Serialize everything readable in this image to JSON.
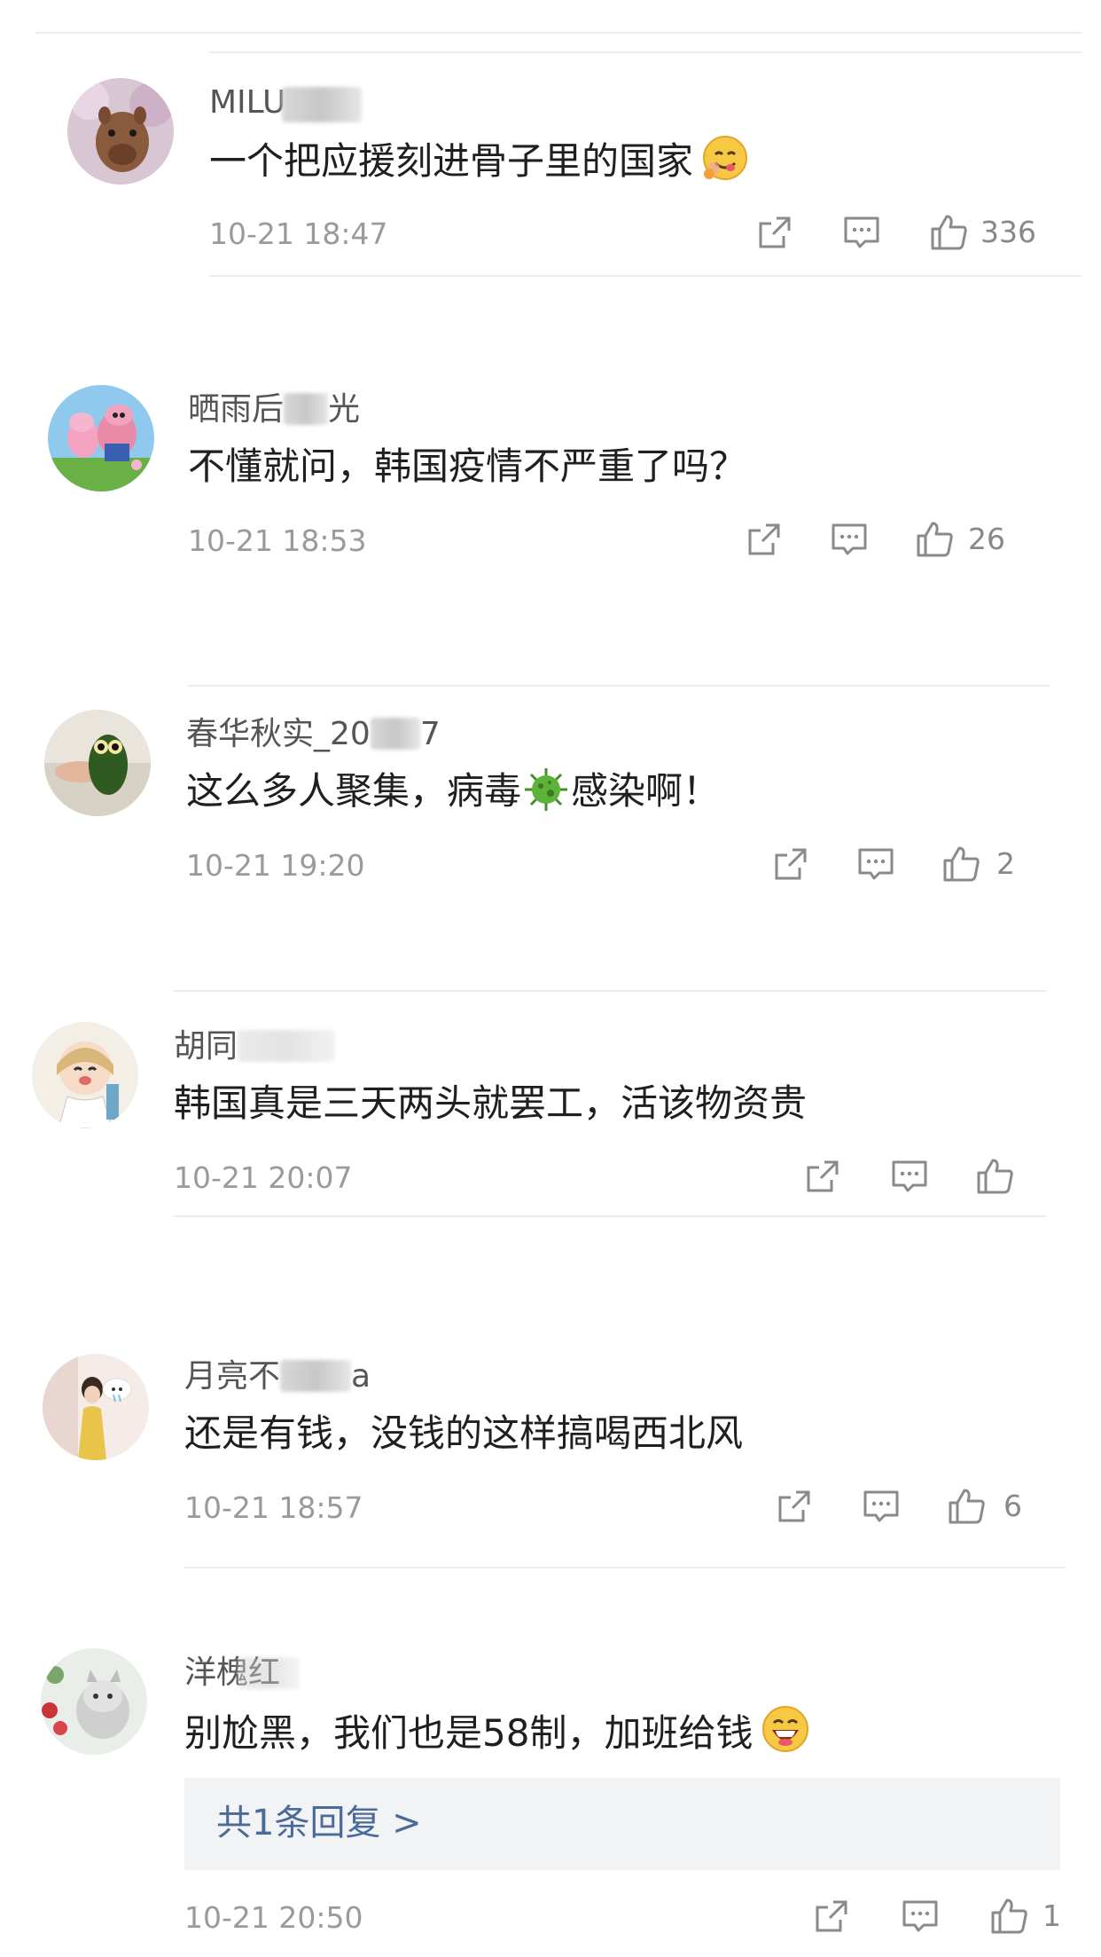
{
  "comments": [
    {
      "name": "MILU",
      "text": "一个把应援刻进骨子里的国家",
      "time": "10-21 18:47",
      "likes": "336",
      "emoji": "face-savoring-icon"
    },
    {
      "name": "晒雨后",
      "name_tail": "光",
      "text": "不懂就问，韩国疫情不严重了吗？",
      "time": "10-21 18:53",
      "likes": "26"
    },
    {
      "name": "春华秋实_20",
      "name_tail": "7",
      "text_a": "这么多人聚集，病毒",
      "text_b": "感染啊！",
      "time": "10-21 19:20",
      "likes": "2"
    },
    {
      "name": "胡同",
      "text": "韩国真是三天两头就罢工，活该物资贵",
      "time": "10-21 20:07",
      "likes": ""
    },
    {
      "name": "月亮不",
      "name_tail": "a",
      "text": "还是有钱，没钱的这样搞喝西北风",
      "time": "10-21 18:57",
      "likes": "6"
    },
    {
      "name": "洋槐红",
      "text": "别尬黑，我们也是58制，加班给钱",
      "time": "10-21 20:50",
      "likes": "1",
      "emoji": "laughing-face-icon",
      "reply_label": "共1条回复 >"
    }
  ],
  "icons": {
    "share": "share-icon",
    "comment": "comment-icon",
    "like": "thumbs-up-icon"
  },
  "colors": {
    "reply_link": "#4a6b9a",
    "meta_gray": "#9a9a9a"
  }
}
